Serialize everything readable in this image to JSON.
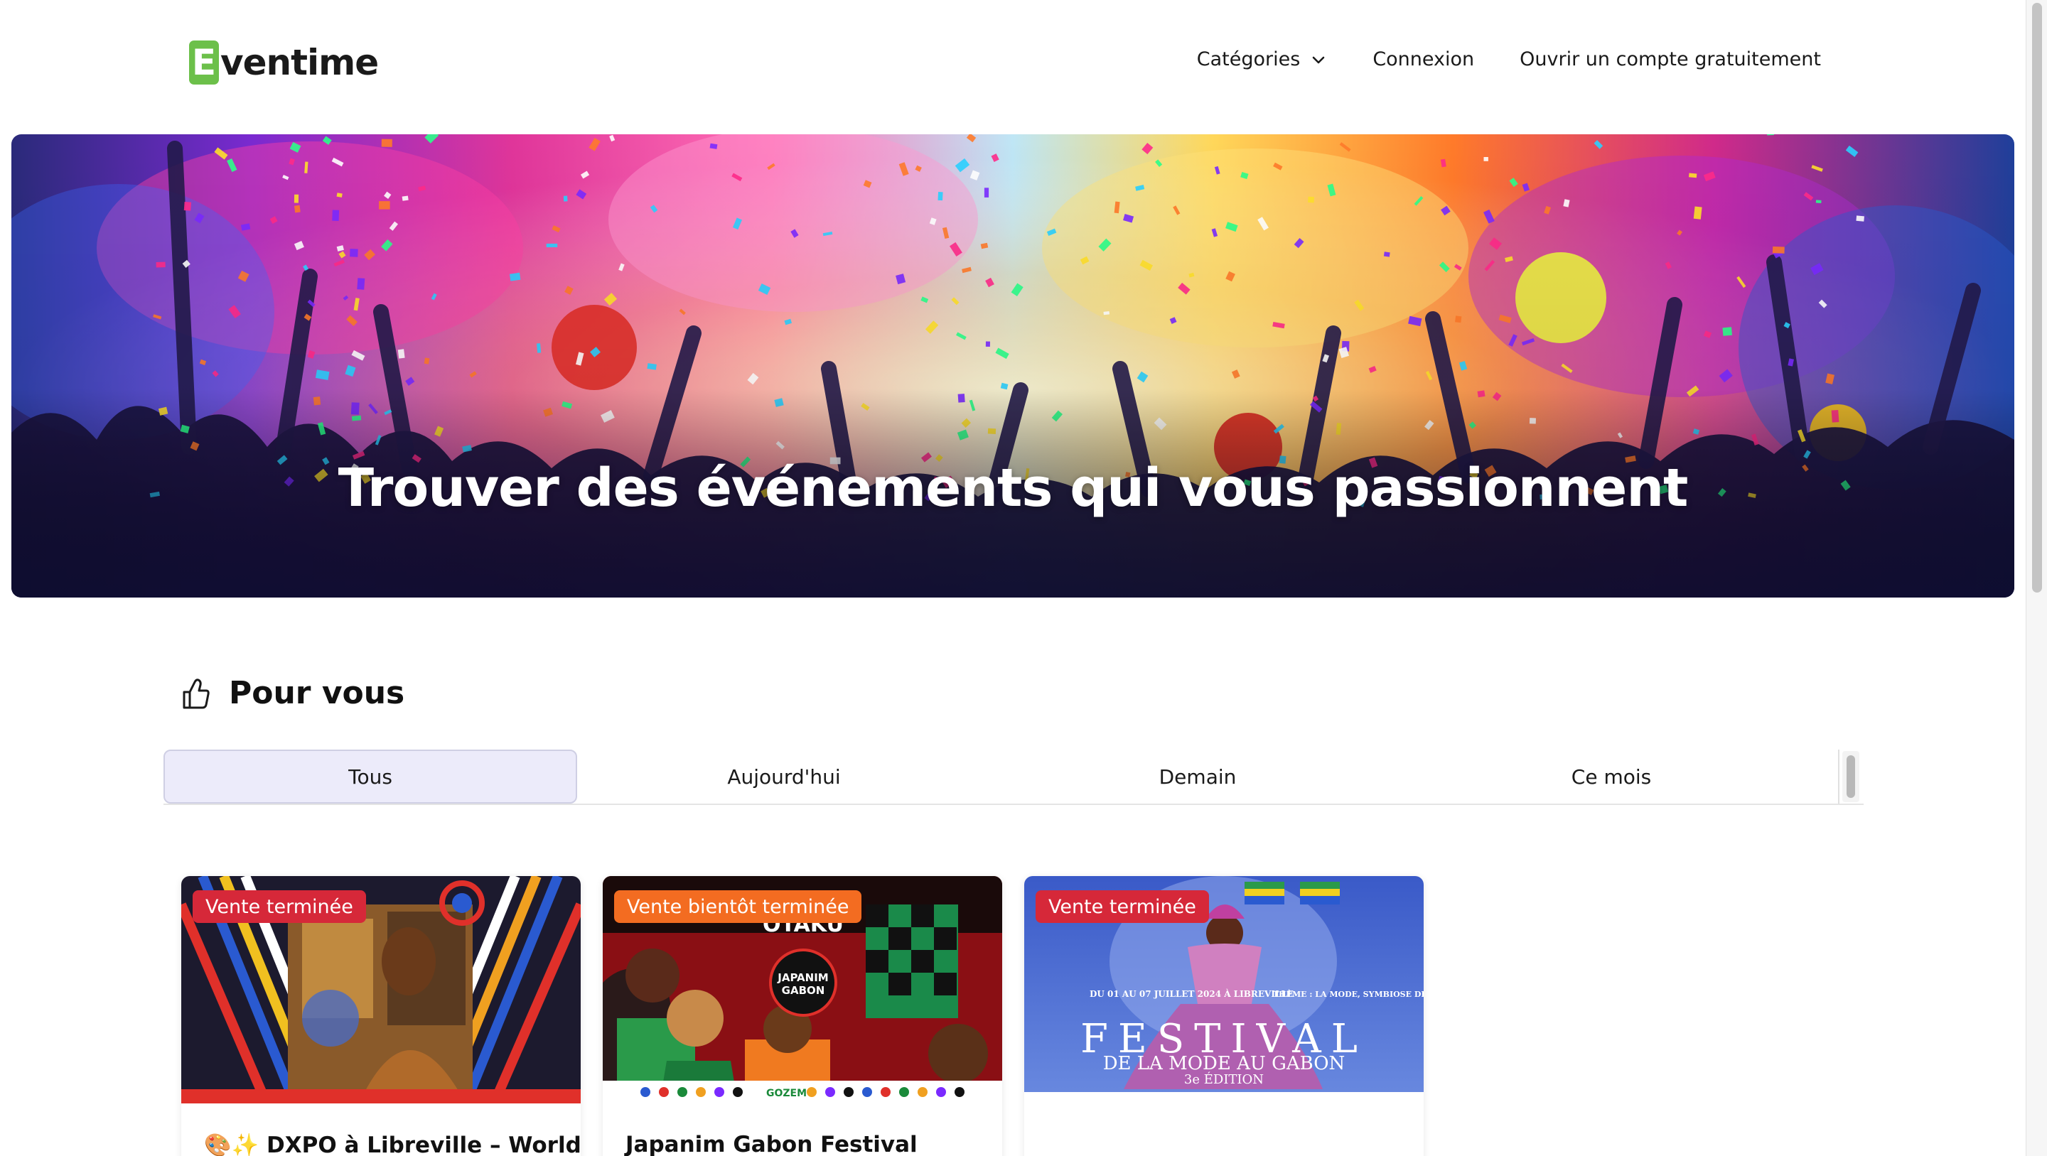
{
  "header": {
    "logo_letter": "E",
    "logo_text": "ventime",
    "nav": {
      "categories": "Catégories",
      "login": "Connexion",
      "signup": "Ouvrir un compte gratuitement"
    }
  },
  "hero": {
    "title": "Trouver des événements qui vous passionnent"
  },
  "section": {
    "title": "Pour vous"
  },
  "tabs": [
    {
      "label": "Tous",
      "active": true
    },
    {
      "label": "Aujourd'hui",
      "active": false
    },
    {
      "label": "Demain",
      "active": false
    },
    {
      "label": "Ce mois",
      "active": false
    }
  ],
  "events": [
    {
      "status": "Vente terminée",
      "status_color": "#d62839",
      "title": "🎨✨ DXPO à Libreville – World"
    },
    {
      "status": "Vente bientôt terminée",
      "status_color": "#f36c21",
      "title": "Japanim Gabon Festival"
    },
    {
      "status": "Vente terminée",
      "status_color": "#d62839",
      "title": ""
    }
  ],
  "poster_text": {
    "otaku": "OTAKU",
    "japanim_logo_line1": "JAPANIM",
    "japanim_logo_line2": "GABON",
    "japanim_sponsor": "GOZEM",
    "festival_word": "FESTIVAL",
    "festival_sub": "DE LA MODE AU GABON",
    "festival_edition": "3e ÉDITION",
    "festival_dates": "DU 01 AU 07 JUILLET 2024 À LIBREVILLE",
    "festival_theme": "THÈME : LA MODE, SYMBIOSE DES CULTURES"
  },
  "colors": {
    "brand_green": "#6cc04a",
    "active_tab_bg": "#ecebfa",
    "badge_red": "#d62839",
    "badge_orange": "#f36c21"
  }
}
